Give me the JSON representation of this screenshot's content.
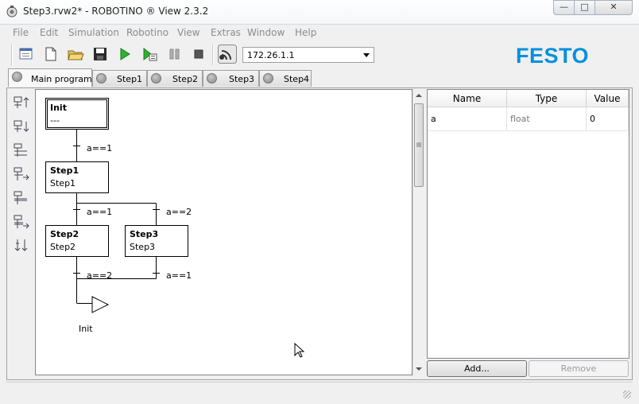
{
  "window": {
    "title": "Step3.rvw2* - ROBOTINO ® View 2.3.2",
    "controls": [
      "—",
      "□",
      "✕"
    ]
  },
  "menu": [
    "File",
    "Edit",
    "Simulation",
    "Robotino",
    "View",
    "Extras",
    "Window",
    "Help"
  ],
  "toolbar": {
    "ip_address": "172.26.1.1",
    "logo": "FESTO",
    "icons": [
      "new-window-icon",
      "new-file-icon",
      "open-folder-icon",
      "save-icon",
      "run-icon",
      "step-run-icon",
      "pause-icon",
      "stop-icon",
      "wifi-icon"
    ]
  },
  "tabs": [
    "Main program",
    "Step1",
    "Step2",
    "Step3",
    "Step4"
  ],
  "active_tab": "Main program",
  "side_tools": [
    "insert-step-above-icon",
    "insert-step-below-icon",
    "insert-branch-left-icon",
    "insert-branch-right-icon",
    "insert-parallel-left-icon",
    "insert-parallel-right-icon",
    "insert-jump-icon"
  ],
  "diagram": {
    "steps": [
      {
        "name": "Init",
        "sub": "---"
      },
      {
        "name": "Step1",
        "sub": "Step1"
      },
      {
        "name": "Step2",
        "sub": "Step2"
      },
      {
        "name": "Step3",
        "sub": "Step3"
      }
    ],
    "conditions": [
      "a==1",
      "a==1",
      "a==2",
      "a==2",
      "a==1"
    ],
    "jump_target": "Init"
  },
  "variables": {
    "columns": [
      "Name",
      "Type",
      "Value"
    ],
    "rows": [
      {
        "name": "a",
        "type": "float",
        "value": "0"
      }
    ]
  },
  "buttons": {
    "add": "Add...",
    "remove": "Remove"
  }
}
